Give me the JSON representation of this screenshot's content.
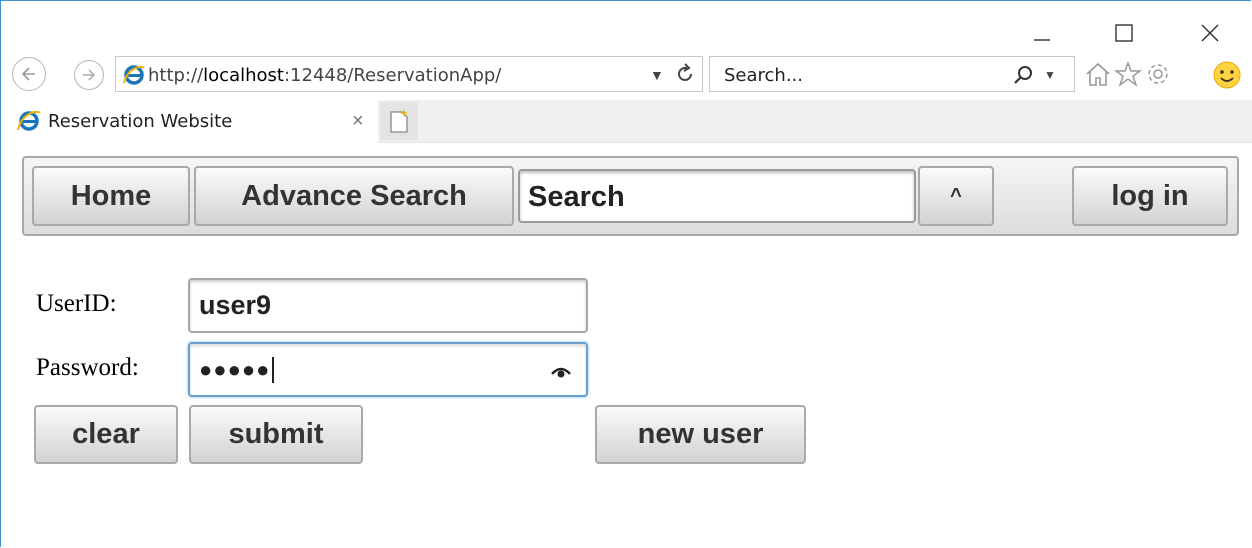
{
  "browser": {
    "back_icon": "back-arrow-icon",
    "forward_icon": "forward-arrow-icon",
    "address": {
      "prefix": "http://",
      "host": "localhost",
      "rest": ":12448/ReservationApp/"
    },
    "search_placeholder": "Search...",
    "tab_title": "Reservation Website",
    "tab_close": "×",
    "window_controls": [
      "minimize-icon",
      "maximize-icon",
      "close-icon"
    ]
  },
  "app": {
    "nav": {
      "home": "Home",
      "advance_search": "Advance Search",
      "search_value": "Search",
      "toggle": "^",
      "login": "log in"
    },
    "form": {
      "userid_label": "UserID:",
      "userid_value": "user9",
      "password_label": "Password:",
      "password_mask": "●●●●●",
      "clear": "clear",
      "submit": "submit",
      "new_user": "new user"
    }
  },
  "colors": {
    "frame_accent": "#3c8fd0",
    "ie_logo": "#1b75bc",
    "focus_border": "#6a9fce"
  }
}
